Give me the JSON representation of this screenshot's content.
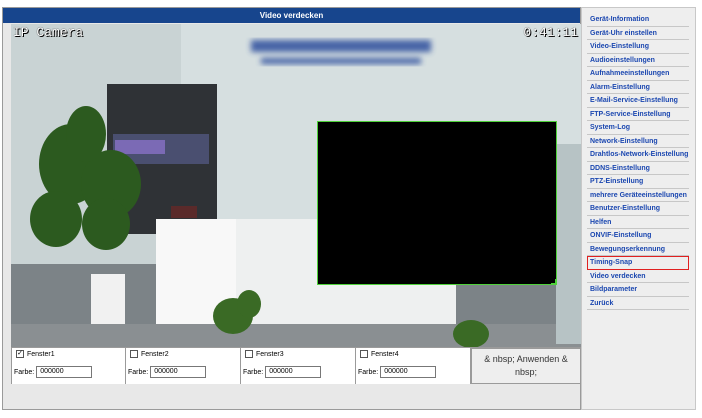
{
  "title": "Video verdecken",
  "video": {
    "camera_name": "IP Camera",
    "time": "0:41:11"
  },
  "windows": [
    {
      "label": "Fenster1",
      "checked": true,
      "color_label": "Farbe:",
      "color_value": "000000"
    },
    {
      "label": "Fenster2",
      "checked": false,
      "color_label": "Farbe:",
      "color_value": "000000"
    },
    {
      "label": "Fenster3",
      "checked": false,
      "color_label": "Farbe:",
      "color_value": "000000"
    },
    {
      "label": "Fenster4",
      "checked": false,
      "color_label": "Farbe:",
      "color_value": "000000"
    }
  ],
  "apply_label": "& nbsp; Anwenden & nbsp;",
  "menu": [
    {
      "label": "Gerät-Information"
    },
    {
      "label": "Gerät-Uhr einstellen"
    },
    {
      "label": "Video-Einstellung"
    },
    {
      "label": "Audioeinstellungen"
    },
    {
      "label": "Aufnahmeeinstellungen"
    },
    {
      "label": "Alarm-Einstellung"
    },
    {
      "label": "E-Mail-Service-Einstellung"
    },
    {
      "label": "FTP-Service-Einstellung"
    },
    {
      "label": "System-Log"
    },
    {
      "label": "Network-Einstellung"
    },
    {
      "label": "Drahtlos-Network-Einstellung"
    },
    {
      "label": "DDNS-Einstellung"
    },
    {
      "label": "PTZ-Einstellung"
    },
    {
      "label": "mehrere Geräteeinstellungen"
    },
    {
      "label": "Benutzer-Einstellung"
    },
    {
      "label": "Helfen"
    },
    {
      "label": "ONVIF-Einstellung"
    },
    {
      "label": "Bewegungserkennung"
    },
    {
      "label": "Timing-Snap",
      "active": true
    },
    {
      "label": "Video verdecken"
    },
    {
      "label": "Bildparameter"
    },
    {
      "label": "Zurück"
    }
  ],
  "colors": {
    "title_bar": "#17458d",
    "menu_link": "#1b47b0",
    "mask_border": "#4fd13a",
    "active_outline": "#e02020"
  }
}
